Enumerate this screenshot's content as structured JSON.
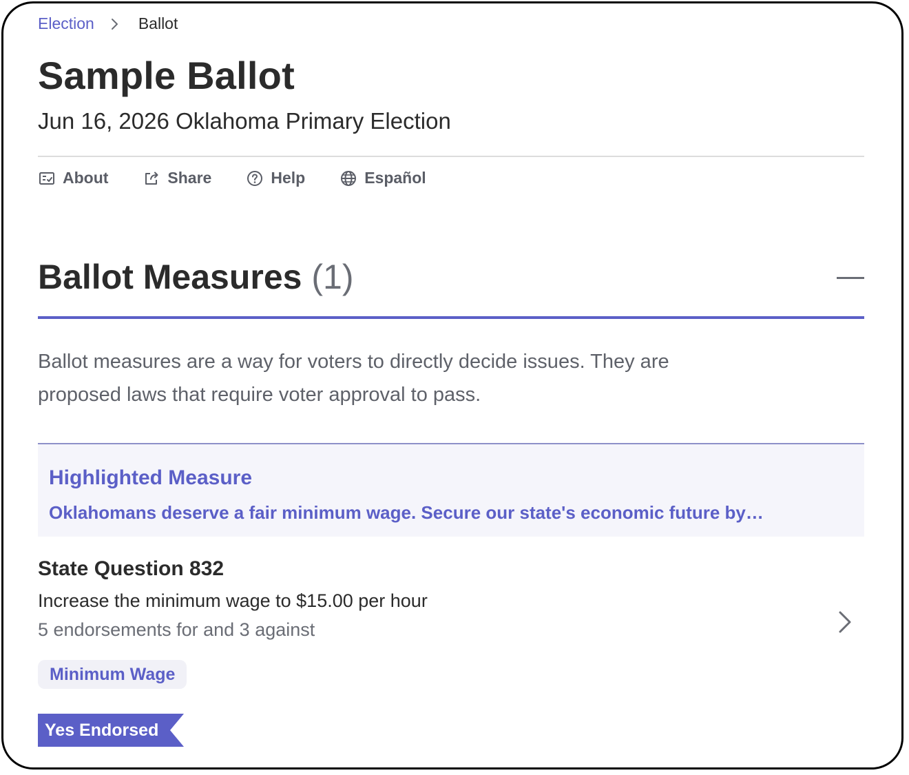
{
  "breadcrumb": {
    "parent": "Election",
    "current": "Ballot"
  },
  "header": {
    "title": "Sample Ballot",
    "subtitle": "Jun 16, 2026 Oklahoma Primary Election"
  },
  "actions": [
    {
      "label": "About",
      "icon": "checklist-icon"
    },
    {
      "label": "Share",
      "icon": "share-icon"
    },
    {
      "label": "Help",
      "icon": "help-circle-icon"
    },
    {
      "label": "Español",
      "icon": "globe-icon"
    }
  ],
  "section": {
    "title": "Ballot Measures",
    "count": "(1)",
    "description": "Ballot measures are a way for voters to directly decide issues. They are proposed laws that require voter approval to pass."
  },
  "highlight": {
    "label": "Highlighted Measure",
    "text": "Oklahomans deserve a fair minimum wage. Secure our state's economic future by…"
  },
  "measure": {
    "title": "State Question 832",
    "description": "Increase the minimum wage to $15.00 per hour",
    "endorsements": "5 endorsements for and 3 against",
    "tag": "Minimum Wage",
    "endorsement_badge": "Yes Endorsed"
  },
  "colors": {
    "accent": "#5b5fc7",
    "text": "#2b2b2b",
    "muted": "#6a6d75",
    "highlight_bg": "#f5f5fb"
  }
}
